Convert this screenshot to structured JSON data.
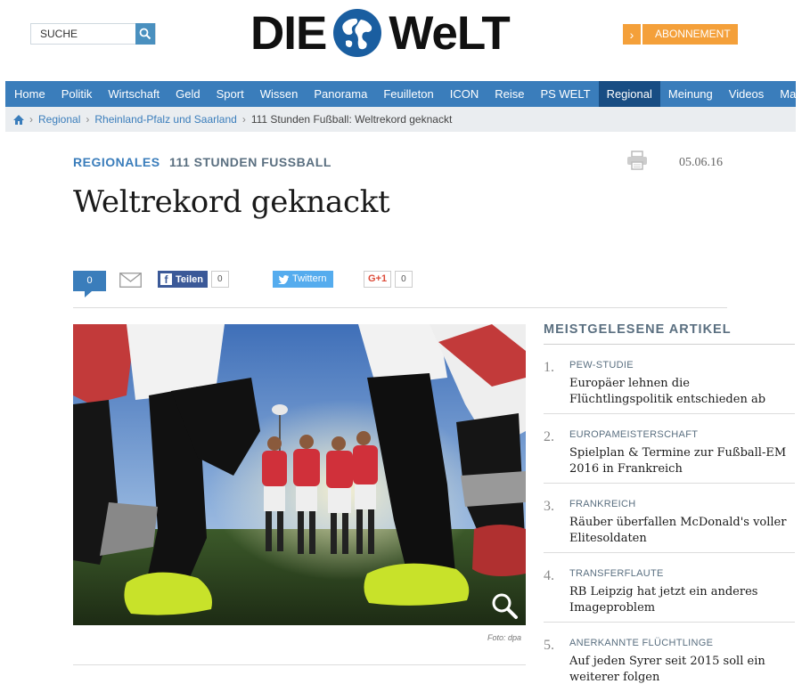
{
  "header": {
    "search_placeholder": "SUCHE",
    "logo_left": "DIE",
    "logo_right": "WeLT",
    "subscribe_label": "ABONNEMENT"
  },
  "nav": {
    "items": [
      "Home",
      "Politik",
      "Wirtschaft",
      "Geld",
      "Sport",
      "Wissen",
      "Panorama",
      "Feuilleton",
      "ICON",
      "Reise",
      "PS WELT",
      "Regional",
      "Meinung",
      "Videos",
      "Markt"
    ],
    "active": "Regional"
  },
  "breadcrumb": {
    "items": [
      "Regional",
      "Rheinland-Pfalz und Saarland"
    ],
    "current": "111 Stunden Fußball: Weltrekord geknackt"
  },
  "article": {
    "section": "REGIONALES",
    "topic": "111 STUNDEN FUSSBALL",
    "date": "05.06.16",
    "headline": "Weltrekord geknackt",
    "photo_credit": "Foto: dpa"
  },
  "share": {
    "comment_count": "0",
    "facebook_label": "Teilen",
    "facebook_count": "0",
    "twitter_label": "Twittern",
    "gplus_label": "G+1",
    "gplus_count": "0"
  },
  "most_read": {
    "title": "MEISTGELESENE ARTIKEL",
    "items": [
      {
        "num": "1.",
        "kicker": "PEW-STUDIE",
        "headline": "Europäer lehnen die Flüchtlingspolitik entschieden ab"
      },
      {
        "num": "2.",
        "kicker": "EUROPAMEISTERSCHAFT",
        "headline": "Spielplan & Termine zur Fußball-EM 2016 in Frankreich"
      },
      {
        "num": "3.",
        "kicker": "FRANKREICH",
        "headline": "Räuber überfallen McDonald's voller Elitesoldaten"
      },
      {
        "num": "4.",
        "kicker": "TRANSFERFLAUTE",
        "headline": "RB Leipzig hat jetzt ein anderes Imageproblem"
      },
      {
        "num": "5.",
        "kicker": "ANERKANNTE FLÜCHTLINGE",
        "headline": "Auf jeden Syrer seit 2015 soll ein weiterer folgen"
      }
    ]
  },
  "colors": {
    "nav_blue": "#3a7dbb",
    "nav_active": "#184d83",
    "accent_orange": "#f4a03a"
  }
}
